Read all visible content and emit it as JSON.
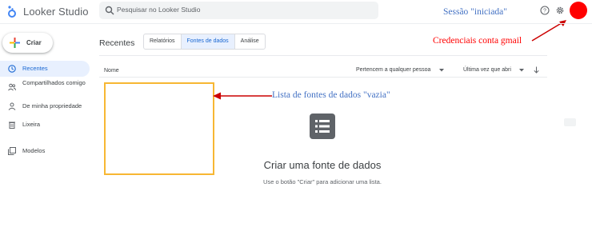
{
  "app": {
    "title": "Looker Studio",
    "search_placeholder": "Pesquisar no Looker Studio",
    "avatar_color": "#ff0000"
  },
  "sidebar": {
    "create_label": "Criar",
    "items": [
      {
        "label": "Recentes",
        "icon": "clock-icon",
        "active": true
      },
      {
        "label": "Compartilhados comigo",
        "icon": "people-icon",
        "active": false
      },
      {
        "label": "De minha propriedade",
        "icon": "person-icon",
        "active": false
      },
      {
        "label": "Lixeira",
        "icon": "trash-icon",
        "active": false
      },
      {
        "label": "Modelos",
        "icon": "templates-icon",
        "active": false
      }
    ]
  },
  "main": {
    "section_title": "Recentes",
    "tabs": [
      {
        "label": "Relatórios",
        "active": false
      },
      {
        "label": "Fontes de dados",
        "active": true
      },
      {
        "label": "Análise",
        "active": false
      }
    ],
    "columns": {
      "name": "Nome",
      "owner_filter": "Pertencem a qualquer pessoa",
      "sort_filter": "Última vez que abri"
    },
    "empty_state": {
      "icon": "list-icon",
      "title": "Criar uma fonte de dados",
      "subtitle": "Use o botão \"Criar\" para adicionar uma lista."
    }
  },
  "annotations": {
    "session": "Sessão \"iniciada\"",
    "credentials": "Credenciais conta gmail",
    "empty_list": "Lista de fontes de dados \"vazia\"",
    "highlight_color": "#f7b733",
    "arrow_color": "#cc0000"
  }
}
